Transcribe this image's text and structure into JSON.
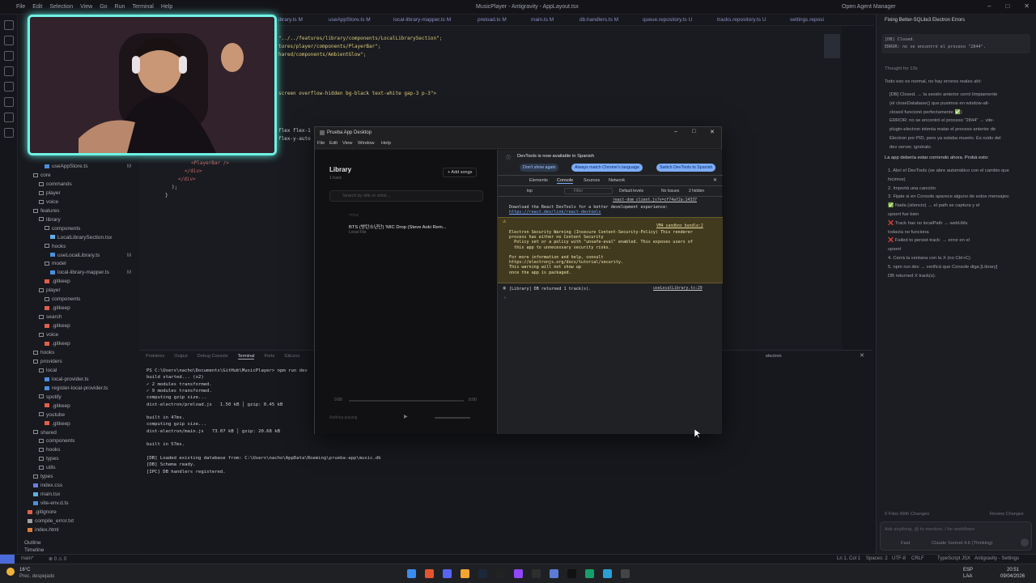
{
  "titlebar": {
    "menus": [
      "File",
      "Edit",
      "Selection",
      "View",
      "Go",
      "Run",
      "Terminal",
      "Help"
    ],
    "title": "MusicPlayer - Antigravity - AppLayout.tsx",
    "account": "Open Agent Manager"
  },
  "tabs": [
    "ibrary.ts M",
    "useAppStore.ts M",
    "local-library-mapper.ts M",
    "preload.ts M",
    "main.ts M",
    "db.handlers.ts M",
    "queue.repository.ts U",
    "tracks.repository.ts U",
    "settings.reposi"
  ],
  "sidebar": {
    "items": [
      {
        "label": "useAppStore.ts",
        "indent": 3,
        "badge": "M",
        "kind": "ts"
      },
      {
        "label": "core",
        "indent": 1,
        "badge": "",
        "kind": "folder"
      },
      {
        "label": "commands",
        "indent": 2,
        "badge": "",
        "kind": "folder"
      },
      {
        "label": "player",
        "indent": 2,
        "badge": "",
        "kind": "folder"
      },
      {
        "label": "voice",
        "indent": 2,
        "badge": "",
        "kind": "folder"
      },
      {
        "label": "features",
        "indent": 1,
        "badge": "",
        "kind": "folder"
      },
      {
        "label": "library",
        "indent": 2,
        "badge": "",
        "kind": "folder"
      },
      {
        "label": "components",
        "indent": 3,
        "badge": "",
        "kind": "folder"
      },
      {
        "label": "LocalLibrarySection.tsx",
        "indent": 4,
        "badge": "",
        "kind": "tsx"
      },
      {
        "label": "hooks",
        "indent": 3,
        "badge": "",
        "kind": "folder"
      },
      {
        "label": "useLocalLibrary.ts",
        "indent": 4,
        "badge": "M",
        "kind": "ts"
      },
      {
        "label": "model",
        "indent": 3,
        "badge": "",
        "kind": "folder"
      },
      {
        "label": "local-library-mapper.ts",
        "indent": 4,
        "badge": "M",
        "kind": "ts"
      },
      {
        "label": ".gitkeep",
        "indent": 3,
        "badge": "",
        "kind": "git"
      },
      {
        "label": "player",
        "indent": 2,
        "badge": "",
        "kind": "folder"
      },
      {
        "label": "components",
        "indent": 3,
        "badge": "",
        "kind": "folder"
      },
      {
        "label": ".gitkeep",
        "indent": 3,
        "badge": "",
        "kind": "git"
      },
      {
        "label": "search",
        "indent": 2,
        "badge": "",
        "kind": "folder"
      },
      {
        "label": ".gitkeep",
        "indent": 3,
        "badge": "",
        "kind": "git"
      },
      {
        "label": "voice",
        "indent": 2,
        "badge": "",
        "kind": "folder"
      },
      {
        "label": ".gitkeep",
        "indent": 3,
        "badge": "",
        "kind": "git"
      },
      {
        "label": "hooks",
        "indent": 1,
        "badge": "",
        "kind": "folder"
      },
      {
        "label": "providers",
        "indent": 1,
        "badge": "",
        "kind": "folder"
      },
      {
        "label": "local",
        "indent": 2,
        "badge": "",
        "kind": "folder"
      },
      {
        "label": "local-provider.ts",
        "indent": 3,
        "badge": "",
        "kind": "ts"
      },
      {
        "label": "register-local-provider.ts",
        "indent": 3,
        "badge": "",
        "kind": "ts"
      },
      {
        "label": "spotify",
        "indent": 2,
        "badge": "",
        "kind": "folder"
      },
      {
        "label": ".gitkeep",
        "indent": 3,
        "badge": "",
        "kind": "git"
      },
      {
        "label": "youtube",
        "indent": 2,
        "badge": "",
        "kind": "folder"
      },
      {
        "label": ".gitkeep",
        "indent": 3,
        "badge": "",
        "kind": "git"
      },
      {
        "label": "shared",
        "indent": 1,
        "badge": "",
        "kind": "folder"
      },
      {
        "label": "components",
        "indent": 2,
        "badge": "",
        "kind": "folder"
      },
      {
        "label": "hooks",
        "indent": 2,
        "badge": "",
        "kind": "folder"
      },
      {
        "label": "types",
        "indent": 2,
        "badge": "",
        "kind": "folder"
      },
      {
        "label": "utils",
        "indent": 2,
        "badge": "",
        "kind": "folder"
      },
      {
        "label": "types",
        "indent": 1,
        "badge": "",
        "kind": "folder"
      },
      {
        "label": "index.css",
        "indent": 1,
        "badge": "",
        "kind": "css"
      },
      {
        "label": "main.tsx",
        "indent": 1,
        "badge": "",
        "kind": "tsx"
      },
      {
        "label": "vite-env.d.ts",
        "indent": 1,
        "badge": "",
        "kind": "ts"
      },
      {
        "label": ".gitignore",
        "indent": 0,
        "badge": "",
        "kind": "git"
      },
      {
        "label": "compile_error.txt",
        "indent": 0,
        "badge": "",
        "kind": "txt"
      },
      {
        "label": "index.html",
        "indent": 0,
        "badge": "",
        "kind": "html"
      }
    ],
    "outline": "Outline",
    "timeline": "Timeline"
  },
  "editor": {
    "lines": [
      "\"../../features/library/components/LocalLibrarySection\";",
      "tures/player/components/PlayerBar\";",
      "hared/components/AmbientGlow\";",
      "screen overflow-hidden bg-black text-white gap-3 p-3\">",
      "flex flex-1",
      "flex-y-auto"
    ],
    "lower_lines": [
      "<PlayerBar />",
      "</div>",
      "</div>",
      ");",
      "}"
    ]
  },
  "panel": {
    "tabs": [
      "Problems",
      "Output",
      "Debug Console",
      "Terminal",
      "Ports",
      "GitLens"
    ],
    "active_tab": "Terminal",
    "term_name": "electron",
    "lines": [
      "PS C:\\Users\\nacho\\Documents\\GitHub\\MusicPlayer> npm run dev",
      "build started... (x2)",
      "✓ 2 modules transformed.",
      "✓ 9 modules transformed.",
      "computing gzip size...",
      "dist-electron/preload.js   1.50 kB │ gzip: 0.45 kB",
      "",
      "built in 47ms.",
      "computing gzip size...",
      "dist-electron/main.js   73.07 kB │ gzip: 20.68 kB",
      "",
      "built in 57ms.",
      "",
      "[DB] Loaded existing database from: C:\\Users\\nacho\\AppData\\Roaming\\prueba-app\\music.db",
      "[DB] Schema ready.",
      "[IPC] DB handlers registered."
    ]
  },
  "app": {
    "title": "Prueba App Desktop",
    "menus": [
      "File",
      "Edit",
      "View",
      "Window",
      "Help"
    ],
    "library_title": "Library",
    "track_count": "1 track",
    "add_songs": "+ Add songs",
    "search_placeholder": "Search by title or artist...",
    "col_title": "TITLE",
    "track_title": "BTS (방탄소년단) 'MIC Drop (Steve Aoki Rem...",
    "track_sub": "Local File",
    "time_start": "0:00",
    "time_end": "0:00",
    "now_playing": "Nothing playing"
  },
  "devtools": {
    "banner": "DevTools is now available in Spanish",
    "btn_dont": "Don't show again",
    "btn_match": "Always match Chrome's language",
    "btn_switch": "Switch DevTools to Spanish",
    "tabs": [
      "Elements",
      "Console",
      "Sources",
      "Network"
    ],
    "active_tab": "Console",
    "context": "top",
    "filter": "Filter",
    "levels": "Default levels",
    "issues": "No Issues",
    "hidden": "2 hidden",
    "msg1_link": "react-dom_client.js?v=cf74af2a:14337",
    "msg1": "Download the React DevTools for a better development experience:",
    "msg1_url": "https://react.dev/link/react-devtools",
    "warn_link": "VM4 sandbox_bundle:2",
    "warn": "Electron Security Warning (Insecure Content-Security-Policy) This renderer\nprocess has either no Content Security\n  Policy set or a policy with \"unsafe-eval\" enabled. This exposes users of\n  this app to unnecessary security risks.\n\nFor more information and help, consult\nhttps://electronjs.org/docs/tutorial/security.\nThis warning will not show up\nonce the app is packaged.",
    "log_link": "useLocalLibrary.ts:29",
    "log": "[Library] DB returned 1 track(s)."
  },
  "chat": {
    "title": "Fixing Better-SQLite3 Electron Errors",
    "quote1": "[DB] Closed.",
    "quote2": "ERROR: no se encontró el proceso \"2844\".",
    "thought": "Thought for 13s",
    "p1": "Todo eso es normal, no hay errores reales ahí:",
    "bullets": [
      "[DB] Closed. → la sesión anterior cerró limpiamente",
      "(el closeDatabase() que pusimos en window-all-",
      "closed funcionó perfectamente ✅)",
      "ERROR: no se encontró el proceso \"2844\" → vite-",
      "plugin-electron intenta matar el proceso anterior de",
      "Electron por PID, pero ya estaba muerto. Es ruido del",
      "dev server, ignóralo."
    ],
    "p2": "La app debería estar corriendo ahora. Probá esto:",
    "steps": [
      "1. Abrí el DevTools (se abre automático con el cambio que",
      "   hicimos)",
      "2. Importá una canción",
      "3. Fijate si en Console aparece alguno de estos mensajes:",
      "   ✅ Nada (silencio) → el path se captura y el",
      "      upsert fue bien",
      "   ❌ Track has no localPath → webUtils",
      "      todavía no funciona",
      "   ❌ Failed to persist track: → error en el",
      "      upsert",
      "4. Cerrá la ventana con la X (no Ctrl+C)",
      "5. npm run dev → verificá que Console diga [Library]",
      "   DB returned X track(s)."
    ],
    "files_changed": "0 Files With Changes",
    "review": "Review Changes",
    "input_placeholder": "Ask anything, @ to mention, / for workflows",
    "model": "Claude Sonnet 4.6 (Thinking)",
    "plan": "Fast"
  },
  "status": {
    "branch": "main*",
    "problems": "⊗ 0 ⚠ 0",
    "position": "Ln 1, Col 1",
    "spaces": "Spaces: 2",
    "encoding": "UTF-8",
    "eol": "CRLF",
    "lang": "TypeScript JSX",
    "brand": "Antigravity - Settings"
  },
  "taskbar": {
    "weather_temp": "16°C",
    "weather_desc": "Prec. despejado",
    "lang1": "ESP",
    "lang2": "LAA",
    "time": "20:51",
    "date": "09/04/2026"
  },
  "colors": {
    "accent": "#6ef2e4",
    "devtools_blue": "#7cacf8",
    "warn_bg": "#413a1f"
  }
}
